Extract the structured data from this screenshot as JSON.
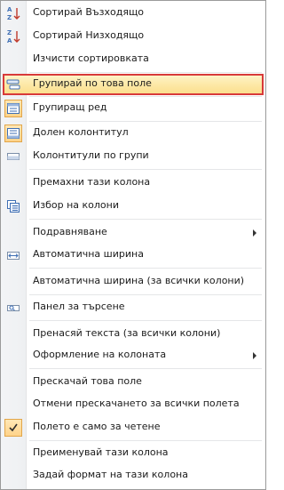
{
  "menu": {
    "items": [
      {
        "label": "Сортирай Възходящо",
        "icon": "sort-ascending-icon"
      },
      {
        "label": "Сортирай Низходящо",
        "icon": "sort-descending-icon"
      },
      {
        "label": "Изчисти сортировката",
        "icon": ""
      },
      {
        "label": "Групирай по това поле",
        "icon": "group-by-field-icon",
        "highlighted": true
      },
      {
        "label": "Групиращ ред",
        "icon": "group-row-icon",
        "checked": true
      },
      {
        "label": "Долен колонтитул",
        "icon": "footer-icon",
        "checked": true
      },
      {
        "label": "Колонтитули по групи",
        "icon": "group-footer-icon"
      },
      {
        "label": "Премахни тази колона",
        "icon": ""
      },
      {
        "label": "Избор на колони",
        "icon": "column-chooser-icon"
      },
      {
        "label": "Подравняване",
        "icon": "",
        "submenu": true
      },
      {
        "label": "Автоматична ширина",
        "icon": "best-fit-icon"
      },
      {
        "label": "Автоматична ширина (за всички колони)",
        "icon": ""
      },
      {
        "label": "Панел за търсене",
        "icon": "find-panel-icon"
      },
      {
        "label": "Пренасяй текста (за всички колони)",
        "icon": ""
      },
      {
        "label": "Оформление на колоната",
        "icon": "",
        "submenu": true
      },
      {
        "label": "Прескачай това поле",
        "icon": ""
      },
      {
        "label": "Отмени прескачането за всички полета",
        "icon": ""
      },
      {
        "label": "Полето е само за четене",
        "icon": "checkmark-icon",
        "checked": true
      },
      {
        "label": "Преименувай тази колона",
        "icon": ""
      },
      {
        "label": "Задай формат на тази колона",
        "icon": ""
      }
    ]
  },
  "colors": {
    "highlight_border": "#d83a3a",
    "highlight_fill": "#fde9a7",
    "checked_fill": "#ffd38a",
    "icon_blue": "#3f6fb4",
    "icon_red": "#c0392b"
  }
}
